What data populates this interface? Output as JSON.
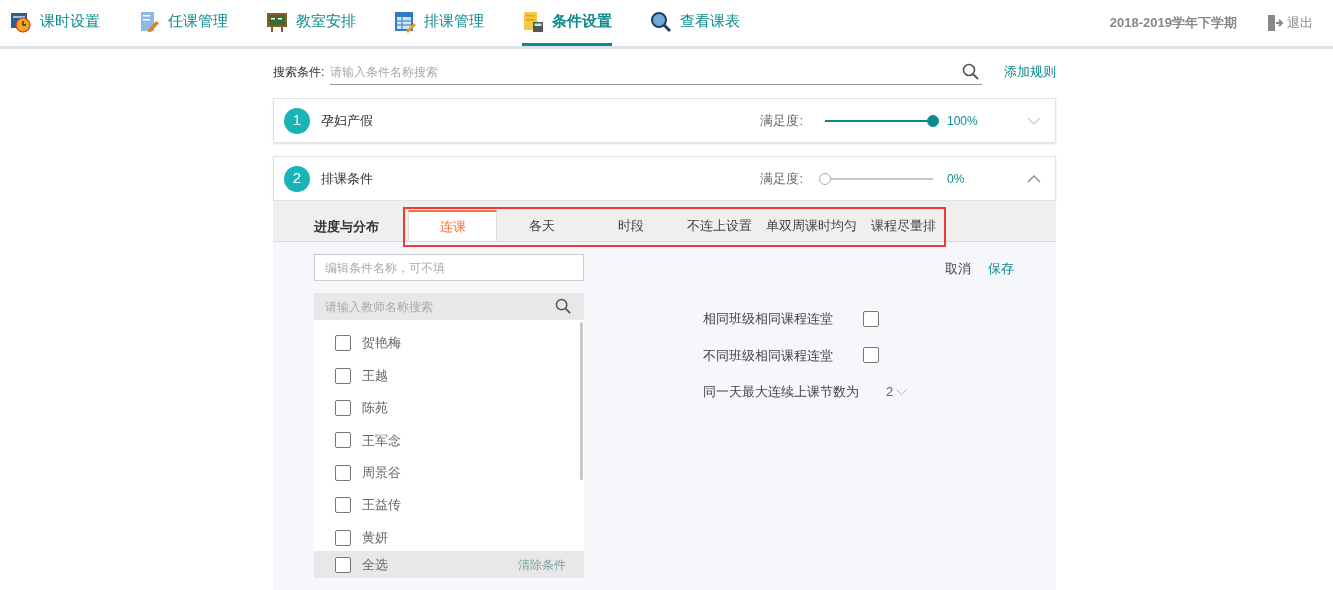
{
  "nav": {
    "items": [
      {
        "label": "课时设置",
        "selected": false
      },
      {
        "label": "任课管理",
        "selected": false
      },
      {
        "label": "教室安排",
        "selected": false
      },
      {
        "label": "排课管理",
        "selected": false
      },
      {
        "label": "条件设置",
        "selected": true
      },
      {
        "label": "查看课表",
        "selected": false
      }
    ],
    "term": "2018-2019学年下学期",
    "logout": "退出"
  },
  "search": {
    "label": "搜索条件:",
    "placeholder": "请输入条件名称搜索",
    "add_rule": "添加规则"
  },
  "conditions": [
    {
      "number": "1",
      "name": "孕妇产假",
      "satisfaction_label": "满足度:",
      "level": 1,
      "reading": "100%",
      "expanded": false
    },
    {
      "number": "2",
      "name": "排课条件",
      "satisfaction_label": "满足度:",
      "level": 0,
      "reading": "0%",
      "expanded": true
    }
  ],
  "editor": {
    "section_label": "进度与分布",
    "tabs": [
      {
        "label": "连课",
        "selected": true
      },
      {
        "label": "各天",
        "selected": false
      },
      {
        "label": "时段",
        "selected": false
      },
      {
        "label": "不连上设置",
        "selected": false
      },
      {
        "label": "单双周课时均匀",
        "selected": false
      },
      {
        "label": "课程尽量排",
        "selected": false
      }
    ],
    "name_field": {
      "placeholder": "编辑条件名称，可不填"
    },
    "teacher_search": {
      "placeholder": "请输入教师名称搜索"
    },
    "teachers": [
      {
        "name": "贺艳梅",
        "checked": false
      },
      {
        "name": "王越",
        "checked": false
      },
      {
        "name": "陈苑",
        "checked": false
      },
      {
        "name": "王军念",
        "checked": false
      },
      {
        "name": "周景谷",
        "checked": false
      },
      {
        "name": "王益传",
        "checked": false
      },
      {
        "name": "黄妍",
        "checked": false
      }
    ],
    "select_all": {
      "label": "全选",
      "checked": false
    },
    "clear": "清除条件",
    "cancel": "取消",
    "save": "保存",
    "options": [
      {
        "kind": "checkbox",
        "label": "相同班级相同课程连堂",
        "checked": false
      },
      {
        "kind": "checkbox",
        "label": "不同班级相同课程连堂",
        "checked": false
      },
      {
        "kind": "select",
        "label": "同一天最大连续上课节数为",
        "value": "2"
      }
    ]
  }
}
